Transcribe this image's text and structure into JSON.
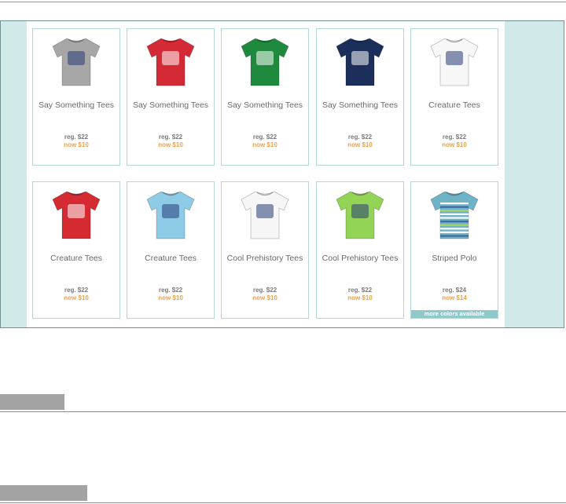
{
  "products": [
    {
      "name": "Say Something Tees",
      "reg": "reg. $22",
      "now": "now $10",
      "shirt_color": "#a7a7a7",
      "icon": "gray-graphic-tee-icon"
    },
    {
      "name": "Say Something Tees",
      "reg": "reg. $22",
      "now": "now $10",
      "shirt_color": "#d42a35",
      "icon": "red-graphic-tee-icon"
    },
    {
      "name": "Say Something Tees",
      "reg": "reg. $22",
      "now": "now $10",
      "shirt_color": "#1f8a3e",
      "icon": "green-graphic-tee-icon"
    },
    {
      "name": "Say Something Tees",
      "reg": "reg. $22",
      "now": "now $10",
      "shirt_color": "#1b2f5a",
      "icon": "navy-graphic-tee-icon"
    },
    {
      "name": "Creature Tees",
      "reg": "reg. $22",
      "now": "now $10",
      "shirt_color": "#f7f7f7",
      "icon": "octopus-tee-icon"
    },
    {
      "name": "Creature Tees",
      "reg": "reg. $22",
      "now": "now $10",
      "shirt_color": "#d62a32",
      "icon": "turtle-tee-icon"
    },
    {
      "name": "Creature Tees",
      "reg": "reg. $22",
      "now": "now $10",
      "shirt_color": "#8ecbe6",
      "icon": "alligator-tee-icon"
    },
    {
      "name": "Cool Prehistory Tees",
      "reg": "reg. $22",
      "now": "now $10",
      "shirt_color": "#f6f6f6",
      "icon": "dinosaur-tee-icon"
    },
    {
      "name": "Cool Prehistory Tees",
      "reg": "reg. $22",
      "now": "now $10",
      "shirt_color": "#93d456",
      "icon": "stegosaurus-tee-icon"
    },
    {
      "name": "Striped Polo",
      "reg": "reg. $24",
      "now": "now $14",
      "shirt_color": "#6fb3c7",
      "icon": "striped-polo-icon",
      "more": "more colors available"
    }
  ],
  "colors": {
    "frame": "#d2e9ea",
    "card_border": "#b3d6da",
    "sale_price": "#e8a24a",
    "more_banner": "#8fc9cc"
  }
}
